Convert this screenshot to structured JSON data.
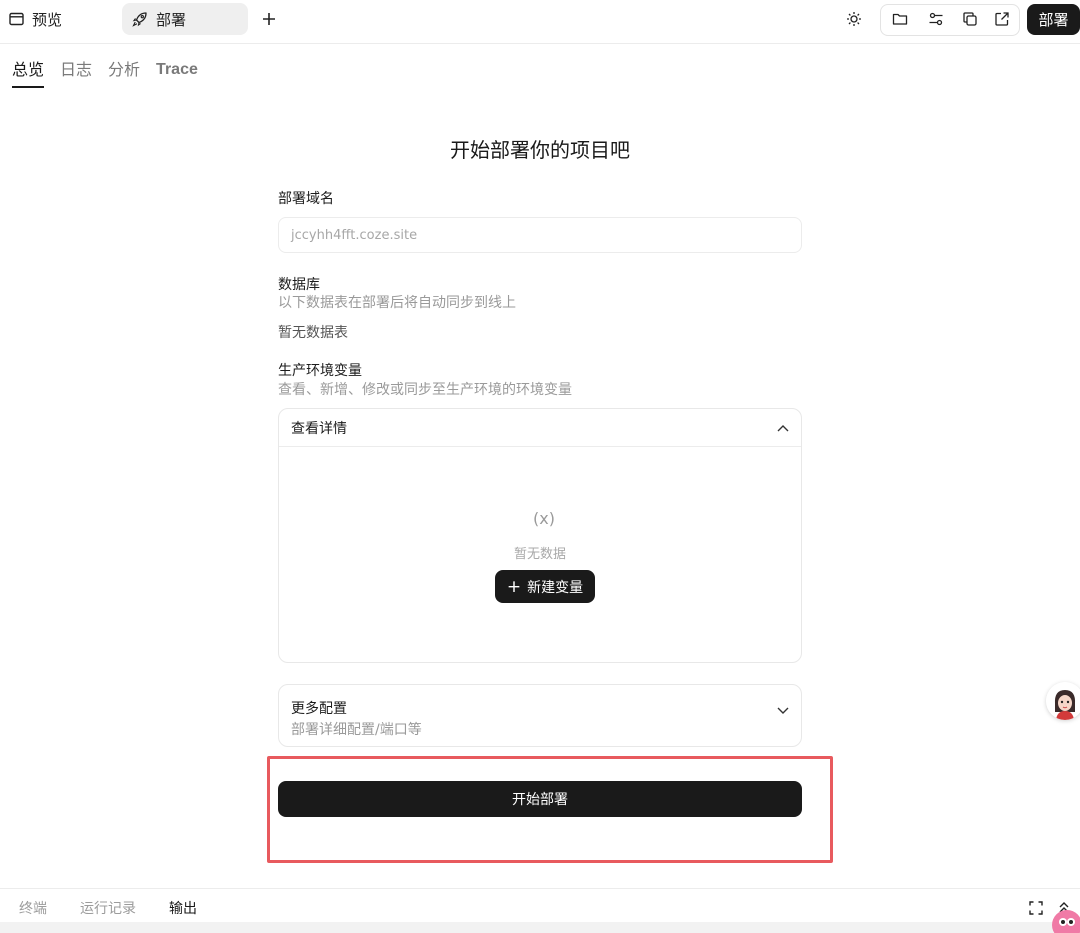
{
  "topbar": {
    "tab_preview": "预览",
    "tab_deploy": "部署",
    "deploy_button": "部署"
  },
  "subtabs": [
    "总览",
    "日志",
    "分析",
    "Trace"
  ],
  "form": {
    "title": "开始部署你的项目吧",
    "domain_label": "部署域名",
    "domain_placeholder": "jccyhh4fft.coze.site",
    "db_label": "数据库",
    "db_desc": "以下数据表在部署后将自动同步到线上",
    "db_empty": "暂无数据表",
    "env_label": "生产环境变量",
    "env_desc": "查看、新增、修改或同步至生产环境的环境变量",
    "env_panel_title": "查看详情",
    "env_empty_icon": "(x)",
    "env_empty": "暂无数据",
    "new_var_button": "新建变量",
    "more_title": "更多配置",
    "more_desc": "部署详细配置/端口等",
    "start_button": "开始部署"
  },
  "bottombar": {
    "tabs": [
      "终端",
      "运行记录",
      "输出"
    ],
    "active": "输出"
  },
  "colors": {
    "dark": "#1a1a1a",
    "highlight": "#e85a5e",
    "muted": "#9a9a9a"
  }
}
